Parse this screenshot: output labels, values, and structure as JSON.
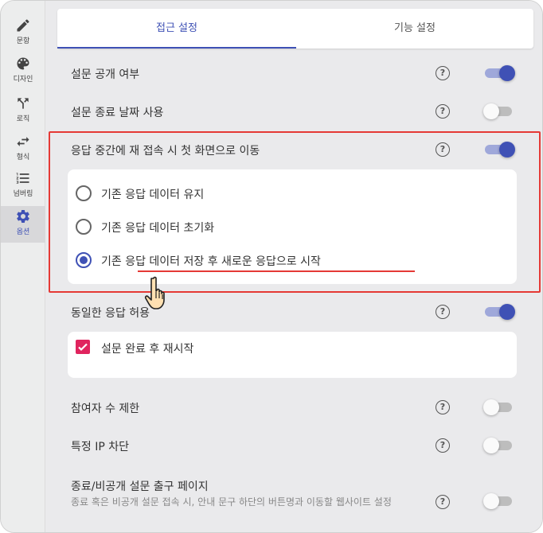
{
  "sidebar": {
    "items": [
      {
        "label": "문항",
        "icon": "pencil-icon"
      },
      {
        "label": "디자인",
        "icon": "palette-icon"
      },
      {
        "label": "로직",
        "icon": "branch-icon"
      },
      {
        "label": "형식",
        "icon": "swap-arrows-icon"
      },
      {
        "label": "넘버링",
        "icon": "numbered-list-icon"
      },
      {
        "label": "옵션",
        "icon": "gear-icon"
      }
    ],
    "active_index": 5
  },
  "tabs": [
    {
      "label": "접근 설정",
      "active": true
    },
    {
      "label": "기능 설정",
      "active": false
    }
  ],
  "settings": {
    "public": {
      "label": "설문 공개 여부",
      "on": true
    },
    "end_date": {
      "label": "설문 종료 날짜 사용",
      "on": false
    },
    "resume": {
      "label": "응답 중간에 재 접속 시 첫 화면으로 이동",
      "on": true
    },
    "duplicate": {
      "label": "동일한 응답 허용",
      "on": true
    },
    "limit": {
      "label": "참여자 수 제한",
      "on": false
    },
    "ip_block": {
      "label": "특정 IP 차단",
      "on": false
    },
    "exit_page": {
      "label": "종료/비공개 설문 출구 페이지",
      "desc": "종료 혹은 비공개 설문 접속 시, 안내 문구 하단의 버튼명과 이동할 웹사이트 설정",
      "on": false
    }
  },
  "resume_options": [
    {
      "label": "기존 응답 데이터 유지",
      "checked": false
    },
    {
      "label": "기존 응답 데이터 초기화",
      "checked": false
    },
    {
      "label": "기존 응답 데이터 저장 후 새로운 응답으로 시작",
      "checked": true
    }
  ],
  "restart_checkbox": {
    "label": "설문 완료 후 재시작",
    "checked": true
  },
  "help_symbol": "?",
  "colors": {
    "accent": "#3f51b5",
    "highlight": "#e53935",
    "checkbox": "#e0245e"
  }
}
